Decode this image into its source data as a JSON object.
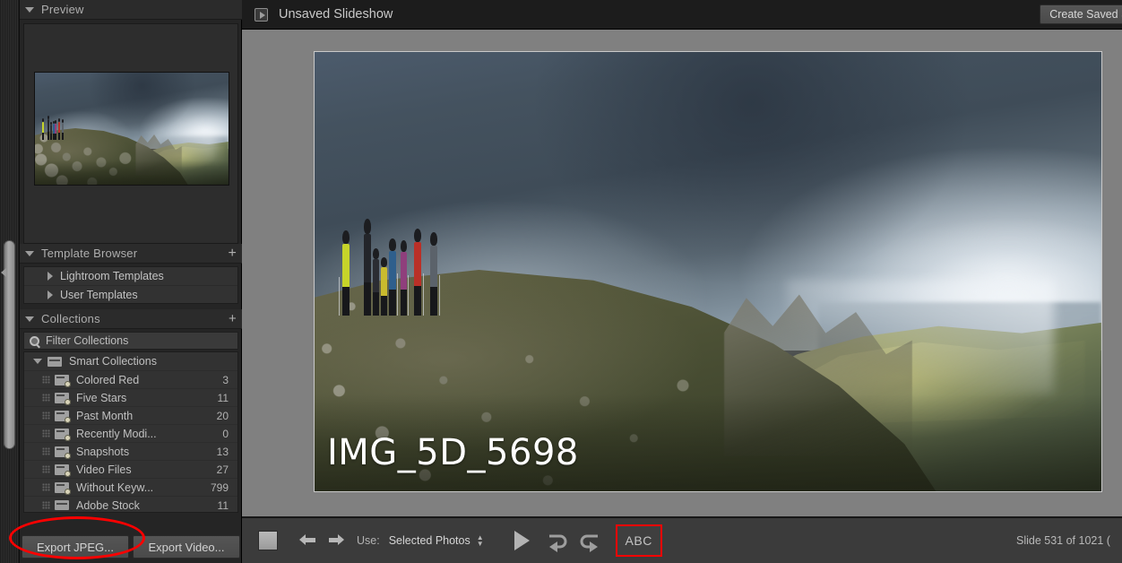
{
  "app": {
    "module": "Slideshow",
    "window_title": "Unsaved Slideshow"
  },
  "topbar": {
    "title": "Unsaved Slideshow",
    "create_saved_button": "Create Saved Sli",
    "slideshow_icon": "slideshow-icon"
  },
  "left_panel": {
    "preview": {
      "header": "Preview",
      "triangle": "disclosure-triangle-down"
    },
    "template_browser": {
      "header": "Template Browser",
      "plus": "+",
      "items": [
        {
          "label": "Lightroom Templates",
          "triangle": "disclosure-triangle-right"
        },
        {
          "label": "User Templates",
          "triangle": "disclosure-triangle-right"
        }
      ]
    },
    "collections": {
      "header": "Collections",
      "plus": "+",
      "filter_placeholder": "Filter Collections",
      "parent": {
        "label": "Smart Collections",
        "triangle": "disclosure-triangle-down"
      },
      "items": [
        {
          "label": "Colored Red",
          "count": "3"
        },
        {
          "label": "Five Stars",
          "count": "11"
        },
        {
          "label": "Past Month",
          "count": "20"
        },
        {
          "label": "Recently Modi...",
          "count": "0"
        },
        {
          "label": "Snapshots",
          "count": "13"
        },
        {
          "label": "Video Files",
          "count": "27"
        },
        {
          "label": "Without Keyw...",
          "count": "799"
        },
        {
          "label": "Adobe Stock",
          "count": "11"
        }
      ]
    },
    "export": {
      "jpeg_label": "Export JPEG...",
      "video_label": "Export Video..."
    }
  },
  "slide": {
    "overlay_title": "IMG_5D_5698",
    "photo_description": "Group of hikers standing on a rocky mountain ridge under a dramatic stormy sky with sunlit green slopes in the distance"
  },
  "toolbar": {
    "stop_icon": "stop-square-icon",
    "prev_icon": "arrow-left-icon",
    "next_icon": "arrow-right-icon",
    "use_label": "Use:",
    "use_value": "Selected Photos",
    "stepper_icon": "stepper-up-down-icon",
    "play_icon": "play-triangle-icon",
    "rotate_right_icon": "rotate-right-icon",
    "rotate_left_icon": "rotate-left-icon",
    "abc_label": "ABC",
    "slide_count": "Slide 531 of 1021 ("
  },
  "annotations": {
    "ellipse_target": "Export JPEG...",
    "rect_target": "ABC",
    "highlight_color": "#ff0000"
  }
}
